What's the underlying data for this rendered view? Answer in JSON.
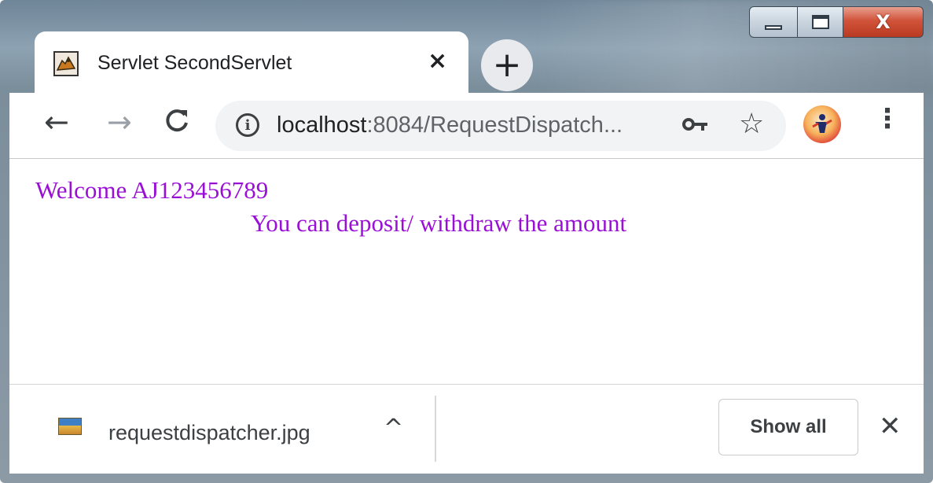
{
  "window": {
    "controls": {
      "minimize": "",
      "maximize": "",
      "close": "X"
    }
  },
  "tab": {
    "title": "Servlet SecondServlet",
    "close_glyph": "×",
    "favicon": "tomcat-icon"
  },
  "new_tab": {
    "glyph": "+"
  },
  "toolbar": {
    "back_glyph": "←",
    "forward_glyph": "→",
    "reload_glyph": "C",
    "info_glyph": "i",
    "url_host": "localhost",
    "url_rest": ":8084/RequestDispatch...",
    "key_glyph": "⚿",
    "star_glyph": "☆",
    "menu_glyph": "⋮",
    "extension": "profile-avatar-icon"
  },
  "page": {
    "welcome": "Welcome AJ123456789",
    "message": "You can deposit/ withdraw the amount",
    "text_color": "#9a0fd6"
  },
  "download_bar": {
    "file_name": "requestdispatcher.jpg",
    "chevron_glyph": "^",
    "show_all_label": "Show all",
    "close_glyph": "✕"
  }
}
